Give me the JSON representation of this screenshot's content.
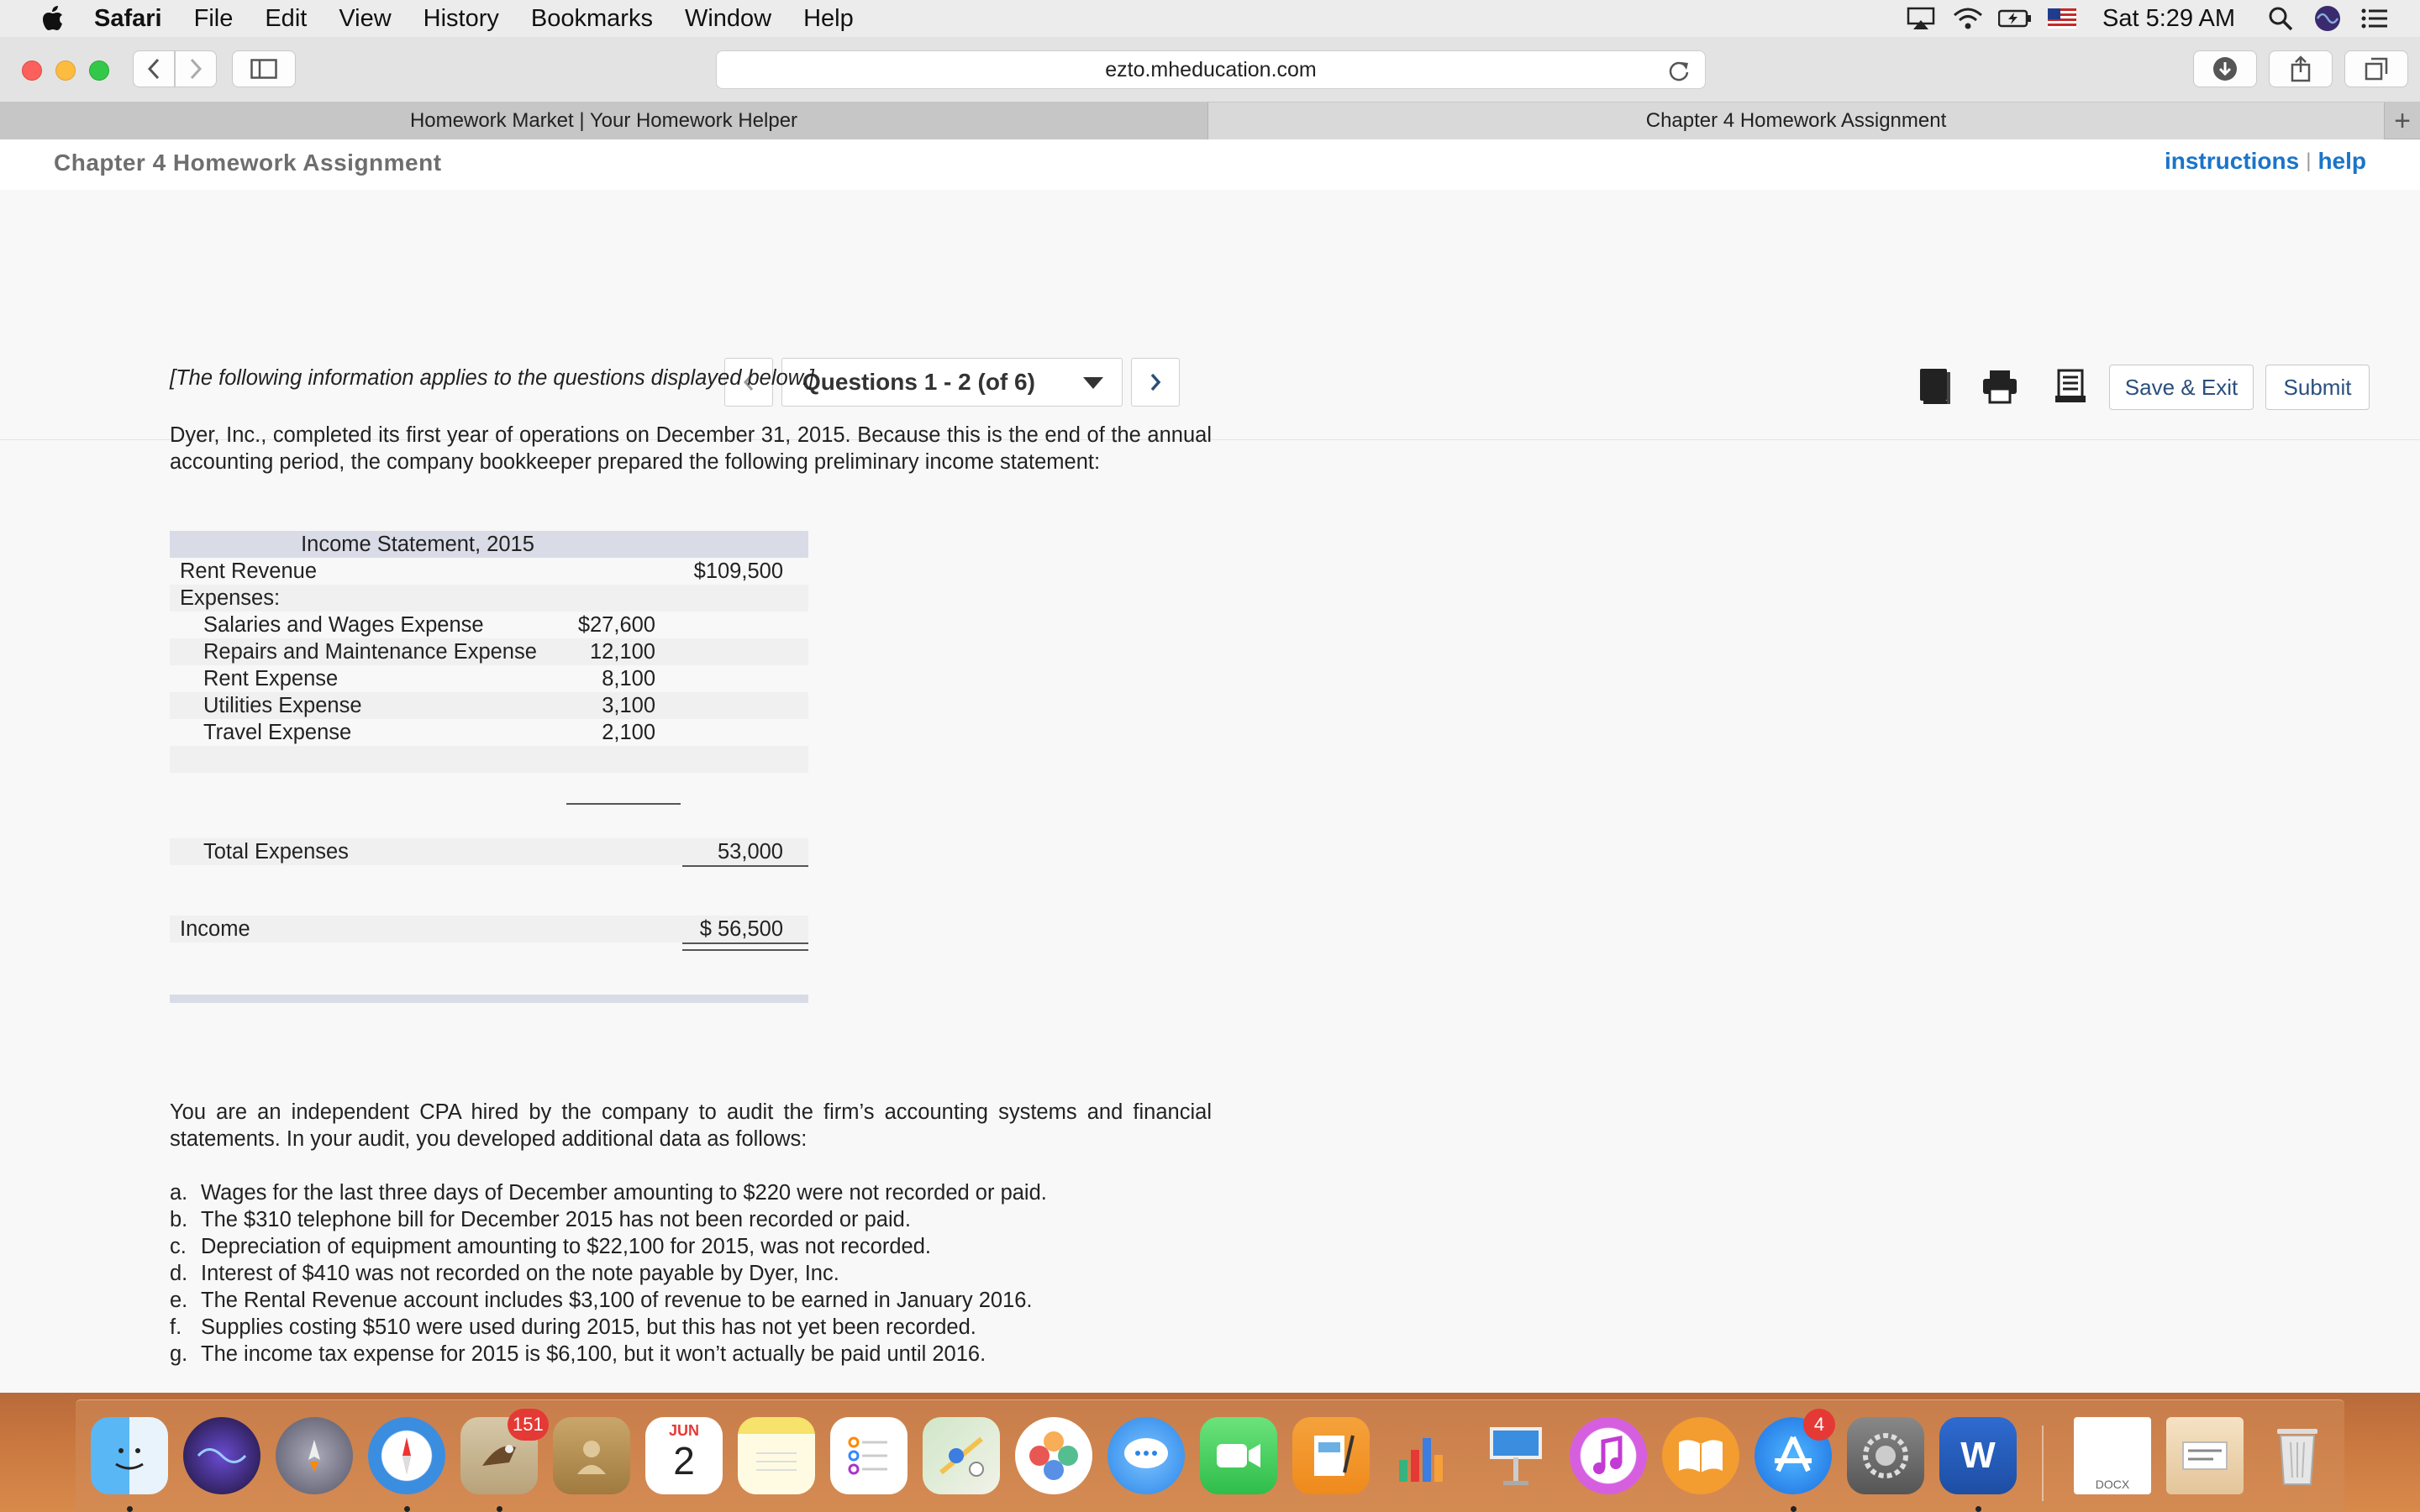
{
  "menubar": {
    "app_name": "Safari",
    "items": [
      "File",
      "Edit",
      "View",
      "History",
      "Bookmarks",
      "Window",
      "Help"
    ],
    "clock": "Sat 5:29 AM"
  },
  "browser": {
    "url": "ezto.mheducation.com",
    "tabs": [
      {
        "title": "Homework Market | Your Homework Helper",
        "active": false
      },
      {
        "title": "Chapter 4 Homework Assignment",
        "active": true
      }
    ]
  },
  "assignment": {
    "title": "Chapter 4 Homework Assignment",
    "instructions_link": "instructions",
    "separator": "|",
    "help_link": "help",
    "question_selector": "Questions 1 - 2 (of 6)",
    "save_exit_label": "Save & Exit",
    "submit_label": "Submit"
  },
  "content": {
    "note": "[The following information applies to the questions displayed below.]",
    "intro": "Dyer, Inc., completed its first year of operations on December 31, 2015. Because this is the end of the annual accounting period, the company bookkeeper prepared the following preliminary income statement:",
    "income_statement": {
      "heading": "Income Statement, 2015",
      "rent_revenue_label": "Rent Revenue",
      "rent_revenue_value": "$109,500",
      "expenses_label": "Expenses:",
      "expenses": [
        {
          "label": "Salaries and Wages Expense",
          "value": "$27,600"
        },
        {
          "label": "Repairs and Maintenance Expense",
          "value": "12,100"
        },
        {
          "label": "Rent Expense",
          "value": "8,100"
        },
        {
          "label": "Utilities Expense",
          "value": "3,100"
        },
        {
          "label": "Travel Expense",
          "value": "2,100"
        }
      ],
      "total_expenses_label": "Total Expenses",
      "total_expenses_value": "53,000",
      "income_label": "Income",
      "income_value": "$ 56,500"
    },
    "audit_intro": "You are an independent CPA hired by the company to audit the firm’s accounting systems and financial statements. In your audit, you developed additional data as follows:",
    "audit_items": [
      {
        "letter": "a.",
        "text": "Wages for the last three days of December amounting to $220 were not recorded or paid."
      },
      {
        "letter": "b.",
        "text": "The $310 telephone bill for December 2015 has not been recorded or paid."
      },
      {
        "letter": "c.",
        "text": "Depreciation of equipment amounting to $22,100 for 2015, was not recorded."
      },
      {
        "letter": "d.",
        "text": "Interest of $410 was not recorded on the note payable by Dyer, Inc."
      },
      {
        "letter": "e.",
        "text": "The Rental Revenue account includes $3,100 of revenue to be earned in January 2016."
      },
      {
        "letter": "f.",
        "text": "Supplies costing $510 were used during 2015, but this has not yet been recorded."
      },
      {
        "letter": "g.",
        "text": "The income tax expense for 2015 is $6,100, but it won’t actually be paid until 2016."
      }
    ]
  },
  "dock": {
    "badges": {
      "mail": "151",
      "app_store": "4"
    },
    "calendar_month": "JUN",
    "calendar_day": "2",
    "word_letter": "W",
    "docx_label": "DOCX"
  },
  "colors": {
    "link_blue": "#1a74c9",
    "button_text": "#2a4f7c",
    "table_header": "#d9dce6"
  }
}
